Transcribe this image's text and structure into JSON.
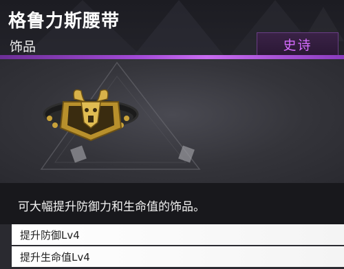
{
  "item": {
    "name": "格鲁力斯腰带",
    "category": "饰品",
    "rarity": "史诗",
    "description": "可大幅提升防御力和生命值的饰品。",
    "stats": [
      {
        "label": "提升防御Lv4"
      },
      {
        "label": "提升生命值Lv4"
      }
    ]
  },
  "colors": {
    "rarity_accent": "#c86cf0",
    "rarity_text": "#d66cff",
    "item_gold": "#c9a23a"
  },
  "icons": {
    "item_icon": "belt-icon"
  }
}
